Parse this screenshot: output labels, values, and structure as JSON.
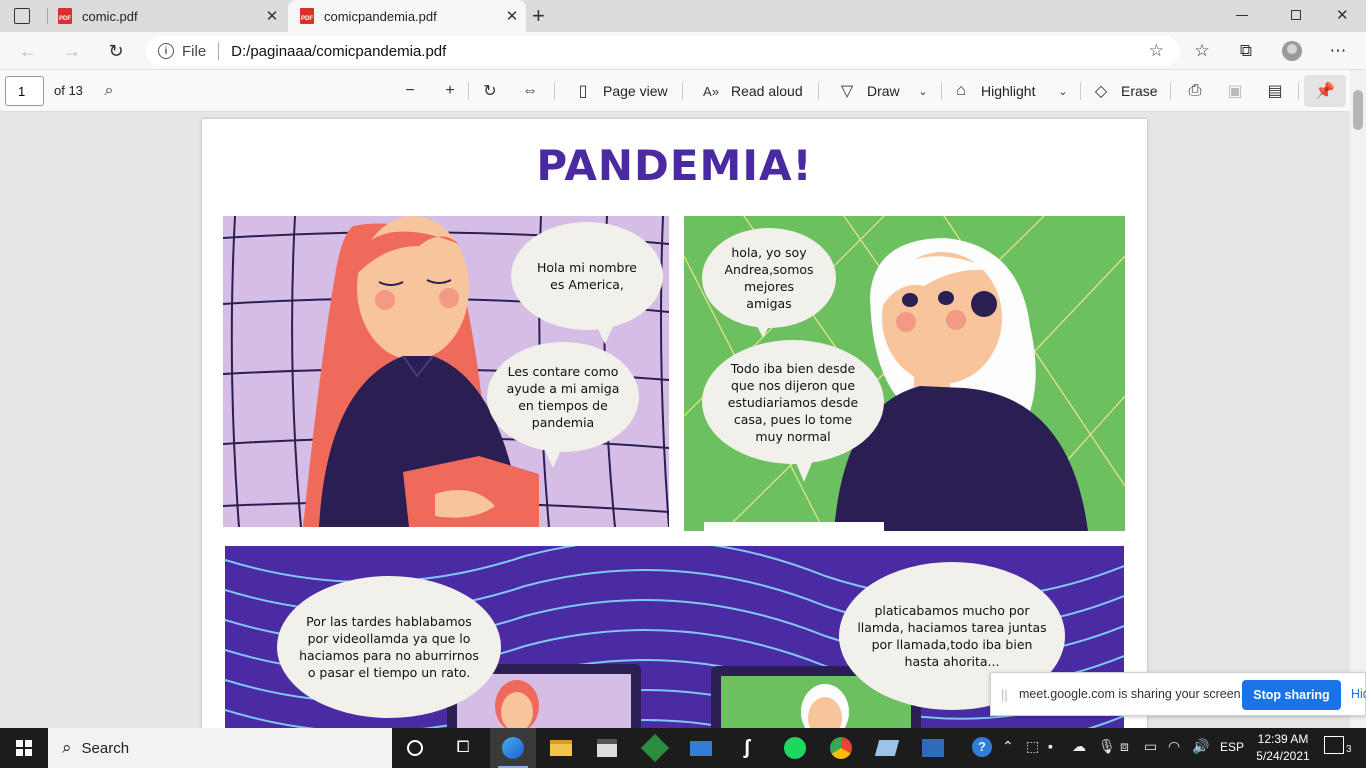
{
  "browser": {
    "tabs": [
      {
        "title": "comic.pdf",
        "active": false
      },
      {
        "title": "comicpandemia.pdf",
        "active": true
      }
    ],
    "new_tab_label": "+",
    "address": {
      "scheme": "File",
      "url": "D:/paginaaa/comicpandemia.pdf"
    }
  },
  "pdf_toolbar": {
    "page_number": "1",
    "page_count": "of 13",
    "page_view": "Page view",
    "read_aloud": "Read aloud",
    "draw": "Draw",
    "highlight": "Highlight",
    "erase": "Erase"
  },
  "comic": {
    "title": "PANDEMIA!",
    "panel1": {
      "bubble1": "Hola mi nombre es America,",
      "bubble2": "Les contare como ayude a mi amiga en tiempos de pandemia"
    },
    "panel2": {
      "bubble1": "hola, yo soy Andrea,somos mejores amigas",
      "bubble2": "Todo iba bien desde que nos dijeron que estudiariamos desde casa, pues lo tome muy normal"
    },
    "panel3": {
      "bubble1": "Por las tardes hablabamos por videollamda ya que lo haciamos para no aburrirnos o pasar el tiempo un rato.",
      "bubble2": "platicabamos mucho por llamda, haciamos tarea juntas por llamada,todo iba bien hasta ahorita..."
    },
    "colors": {
      "title": "#4a2aa0",
      "panel1_bg": "#d5bde6",
      "panel2_bg": "#6cc05f",
      "panel3_bg": "#4b2ba3"
    }
  },
  "share_notification": {
    "message": "meet.google.com is sharing your screen.",
    "stop_label": "Stop sharing",
    "hide_label": "Hide"
  },
  "taskbar": {
    "search_placeholder": "Search",
    "language": "ESP",
    "time": "12:39 AM",
    "date": "5/24/2021",
    "notification_count": "3"
  }
}
